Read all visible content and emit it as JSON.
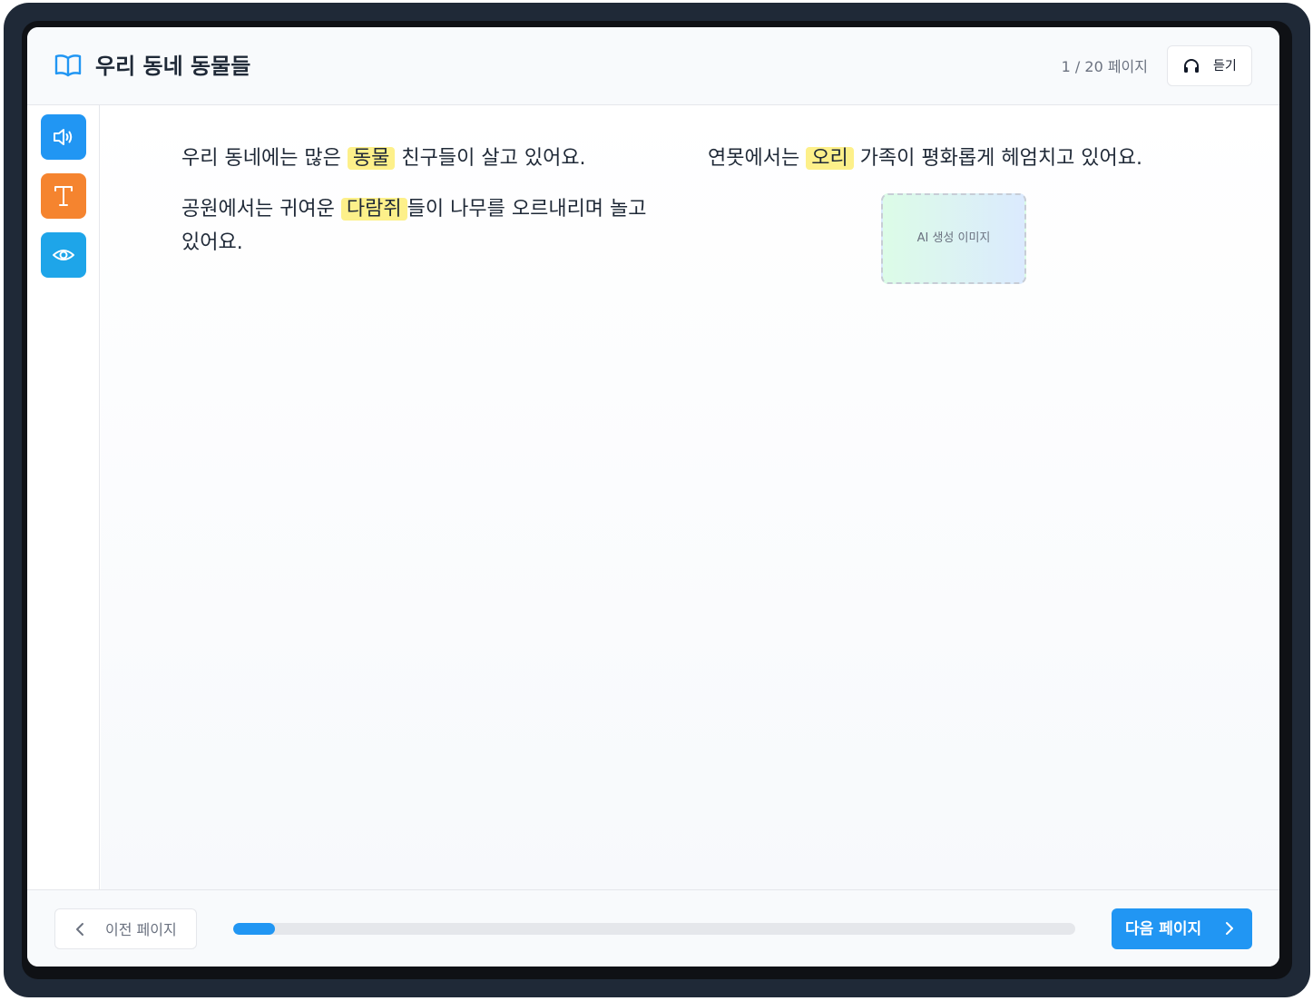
{
  "header": {
    "title": "우리 동네 동물들",
    "page_counter": "1 / 20 페이지",
    "listen_label": "듣기"
  },
  "sidebar": {
    "tools": [
      {
        "name": "audio",
        "icon": "speaker-icon",
        "color": "#2196f3"
      },
      {
        "name": "text",
        "icon": "text-t-icon",
        "color": "#f5842f"
      },
      {
        "name": "view",
        "icon": "eye-icon",
        "color": "#1ea5e9"
      }
    ]
  },
  "story": {
    "p1": {
      "before": "우리 동네에는 많은",
      "highlight": "동물",
      "after": "친구들이 살고 있어요."
    },
    "p2": {
      "before": "공원에서는 귀여운",
      "highlight": "다람쥐",
      "after": "들이 나무를 오르내리며 놀고",
      "line2": "있어요."
    },
    "p3": {
      "before": "연못에서는",
      "highlight": "오리",
      "after": "가족이 평화롭게 헤엄치고 있어요."
    },
    "image_placeholder": "AI 생성 이미지"
  },
  "footer": {
    "prev_label": "이전 페이지",
    "next_label": "다음 페이지",
    "progress_percent": 5
  },
  "colors": {
    "accent": "#2196f3",
    "highlight": "#fdf08a",
    "frame": "#1f2937"
  }
}
